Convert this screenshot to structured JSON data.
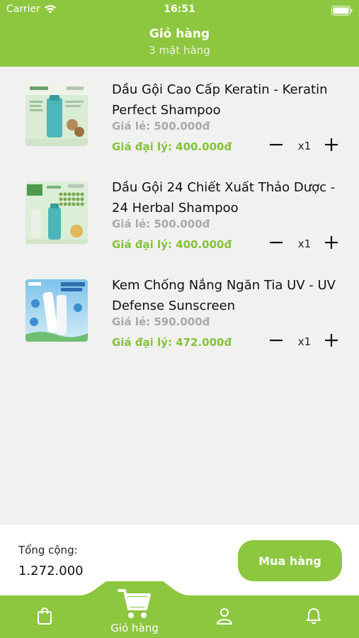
{
  "status_bar": {
    "carrier": "Carrier",
    "time": "16:51"
  },
  "header": {
    "title": "Giỏ hàng",
    "subtitle": "3 mặt hàng"
  },
  "colors": {
    "accent": "#8dc63f",
    "agent_price": "#84c23a",
    "retail_price": "#a9a9a9",
    "background": "#f1f1f1"
  },
  "cart": {
    "items": [
      {
        "name": "Dầu Gội Cao Cấp Keratin - Keratin Perfect Shampoo",
        "retail_price": "Giá lẻ: 500.000đ",
        "agent_price": "Giá đại lý: 400.000đ",
        "quantity": "x1"
      },
      {
        "name": "Dầu Gội 24 Chiết Xuất Thảo Dược - 24 Herbal Shampoo",
        "retail_price": "Giá lẻ: 500.000đ",
        "agent_price": "Giá đại lý: 400.000đ",
        "quantity": "x1"
      },
      {
        "name": "Kem Chống Nắng Ngăn Tia UV - UV Defense Sunscreen",
        "retail_price": "Giá lẻ: 590.000đ",
        "agent_price": "Giá đại lý: 472.000đ",
        "quantity": "x1"
      }
    ]
  },
  "footer": {
    "total_label": "Tổng cộng:",
    "total_value": "1.272.000",
    "buy_button": "Mua hàng"
  },
  "tabbar": {
    "active_label": "Giỏ hàng"
  },
  "icons": [
    "wifi-icon",
    "battery-icon",
    "minus-icon",
    "plus-icon",
    "shopping-bag-icon",
    "cart-icon",
    "user-icon",
    "bell-icon"
  ]
}
